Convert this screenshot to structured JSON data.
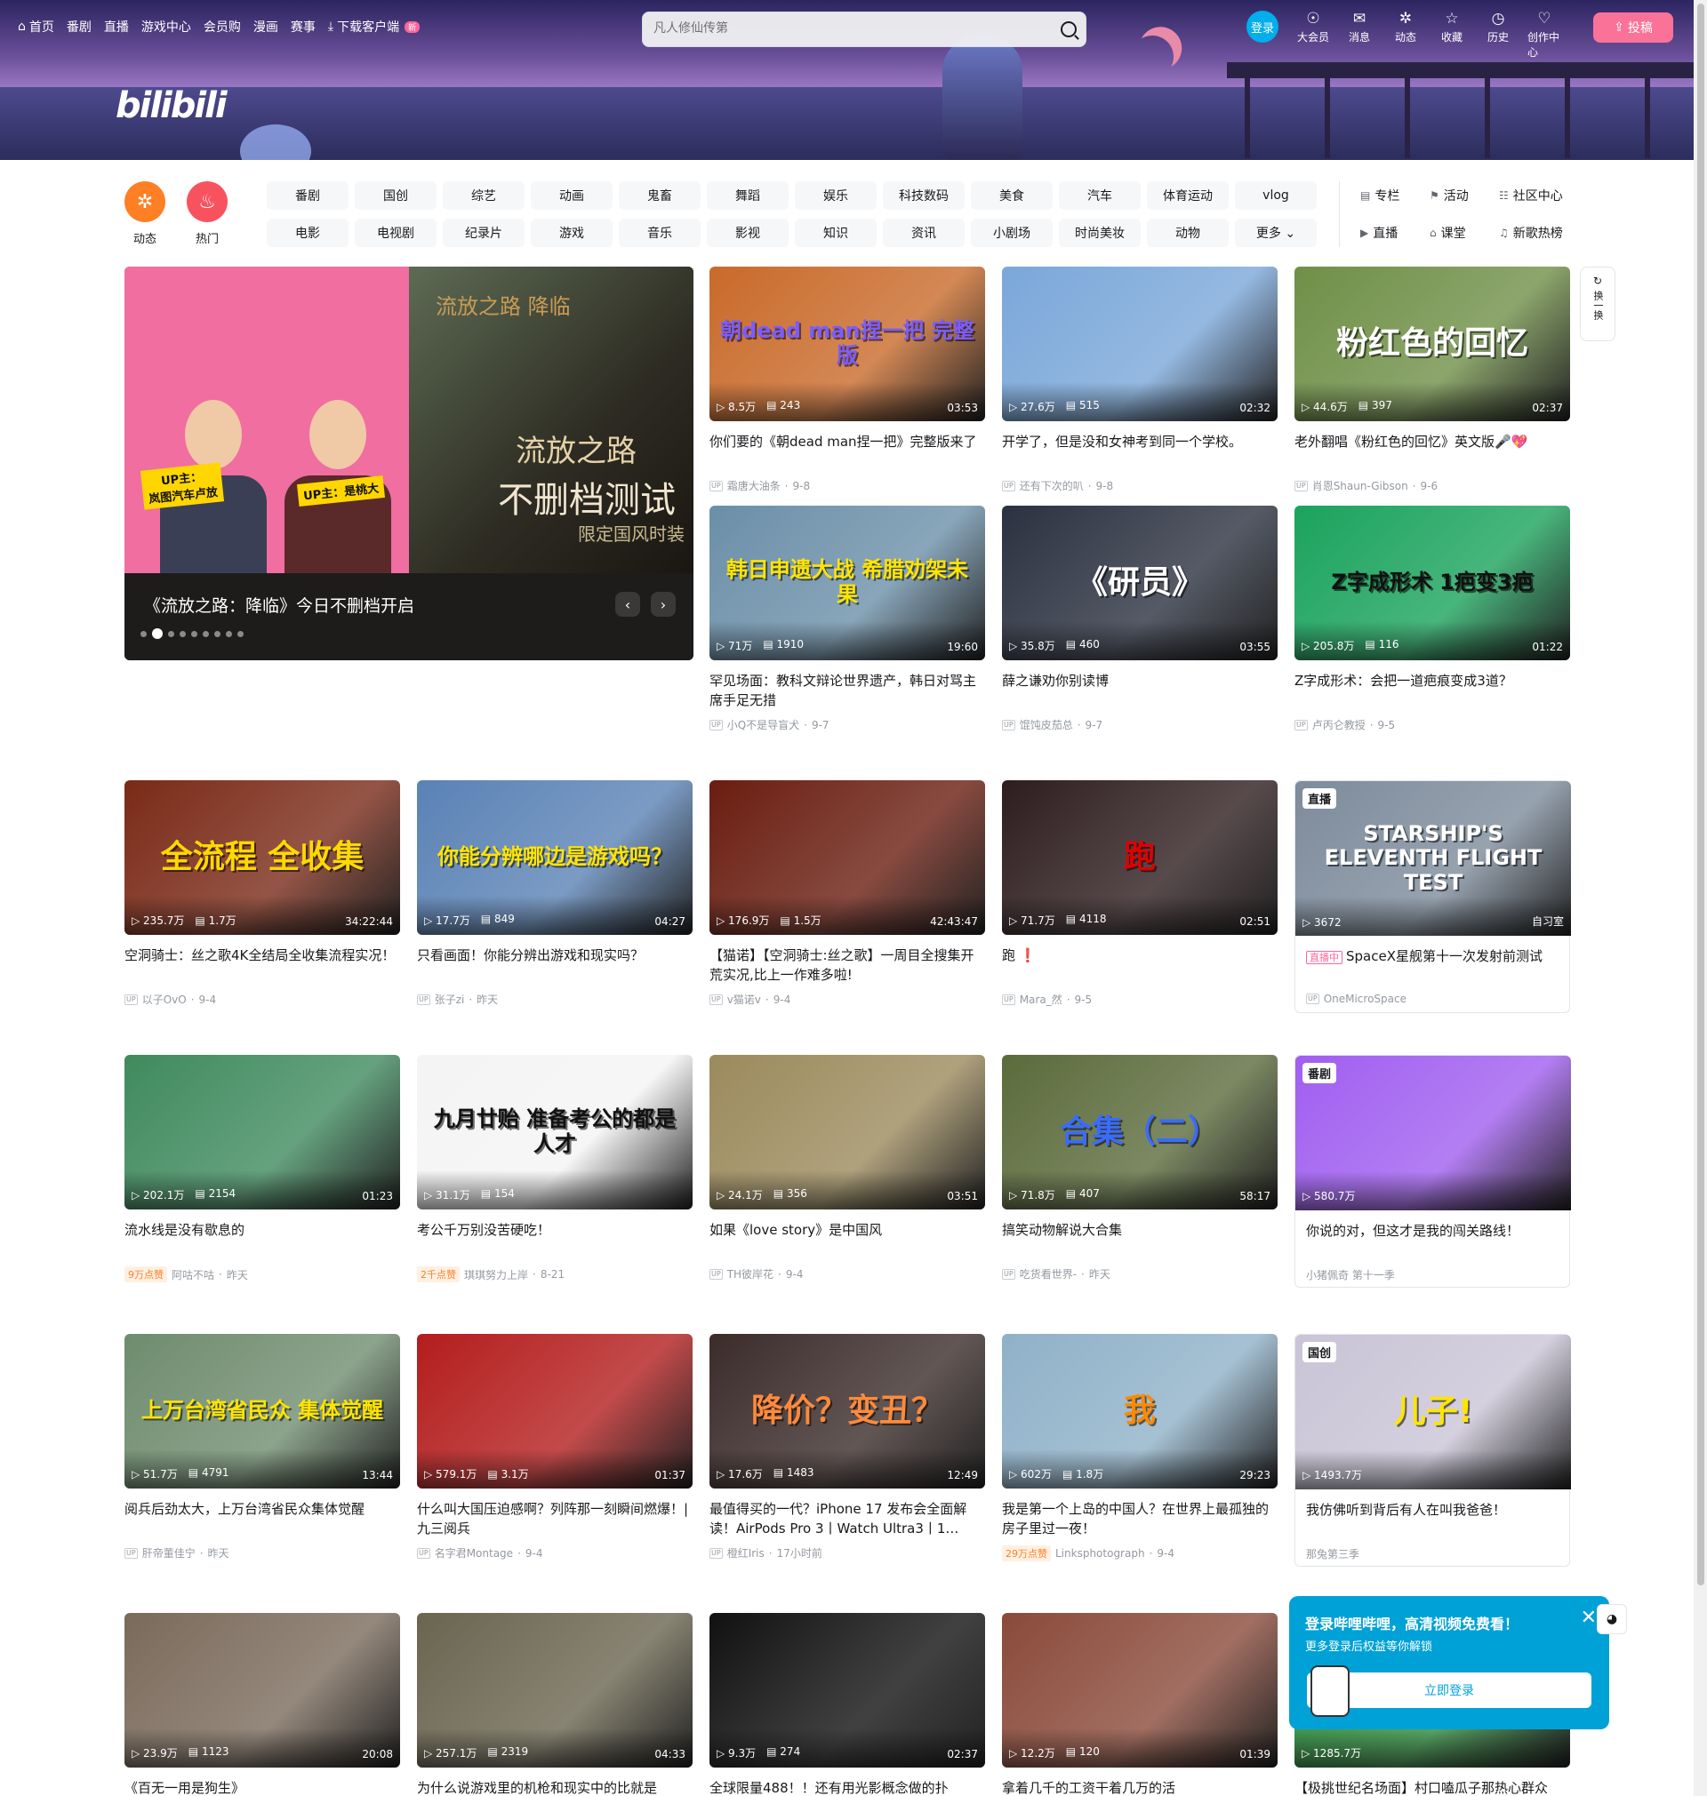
{
  "header": {
    "nav": [
      {
        "label": "首页",
        "icon": "home-icon"
      },
      {
        "label": "番剧"
      },
      {
        "label": "直播"
      },
      {
        "label": "游戏中心"
      },
      {
        "label": "会员购"
      },
      {
        "label": "漫画"
      },
      {
        "label": "赛事"
      },
      {
        "label": "下载客户端",
        "icon": "download-icon",
        "badge": "新"
      }
    ],
    "logo_text": "bilibili",
    "search_placeholder": "凡人修仙传第",
    "login_label": "登录",
    "icons": [
      {
        "label": "大会员",
        "glyph": "☉"
      },
      {
        "label": "消息",
        "glyph": "✉"
      },
      {
        "label": "动态",
        "glyph": "✲"
      },
      {
        "label": "收藏",
        "glyph": "☆"
      },
      {
        "label": "历史",
        "glyph": "◷"
      },
      {
        "label": "创作中心",
        "glyph": "♡"
      }
    ],
    "upload_label": "投稿"
  },
  "channels": {
    "circles": [
      {
        "label": "动态",
        "color": "#ff7f24",
        "glyph": "✲"
      },
      {
        "label": "热门",
        "color": "#f9525f",
        "glyph": "♨"
      }
    ],
    "tags": [
      "番剧",
      "国创",
      "综艺",
      "动画",
      "鬼畜",
      "舞蹈",
      "娱乐",
      "科技数码",
      "美食",
      "汽车",
      "体育运动",
      "vlog",
      "电影",
      "电视剧",
      "纪录片",
      "游戏",
      "音乐",
      "影视",
      "知识",
      "资讯",
      "小剧场",
      "时尚美妆",
      "动物",
      "更多 ⌄"
    ],
    "side": [
      {
        "label": "专栏",
        "glyph": "▤"
      },
      {
        "label": "活动",
        "glyph": "⚑"
      },
      {
        "label": "社区中心",
        "glyph": "☷"
      },
      {
        "label": "直播",
        "glyph": "▶"
      },
      {
        "label": "课堂",
        "glyph": "⌂"
      },
      {
        "label": "新歌热榜",
        "glyph": "♫"
      }
    ]
  },
  "carousel": {
    "title": "《流放之路：降临》今日不删档开启",
    "left_label_1": "UP主：\n岚图汽车卢放",
    "left_label_2": "UP主：是桃大",
    "right_text_1": "流放之路",
    "right_text_2": "不删档测试",
    "right_text_3": "限定国风时装",
    "right_logo": "流放之路 降临"
  },
  "refresh_label": "换一换",
  "videos": [
    {
      "title": "你们要的《朝dead man捏一把》完整版来了",
      "author": "霜唐大油条",
      "date": "9-8",
      "views": "8.5万",
      "danmaku": "243",
      "duration": "03:53",
      "overlay": "朝dead man捏一把 完整版",
      "bg": "#c96a2a",
      "oc": "#7b5cff"
    },
    {
      "title": "开学了，但是没和女神考到同一个学校。",
      "author": "还有下次的叭",
      "date": "9-8",
      "views": "27.6万",
      "danmaku": "515",
      "duration": "02:32",
      "overlay": "",
      "bg": "#7aa7d9",
      "oc": "#fff"
    },
    {
      "title": "老外翻唱《粉红色的回忆》英文版🎤💖",
      "author": "肖恩Shaun-Gibson",
      "date": "9-6",
      "views": "44.6万",
      "danmaku": "397",
      "duration": "02:37",
      "overlay": "粉红色的回忆",
      "bg": "#6f8f47",
      "oc": "#fff"
    },
    {
      "title": "罕见场面：教科文辩论世界遗产，韩日对骂主席手足无措",
      "author": "小Q不是导盲犬",
      "date": "9-7",
      "views": "71万",
      "danmaku": "1910",
      "duration": "19:60",
      "overlay": "韩日申遗大战 希腊劝架未果",
      "bg": "#6b8fa8",
      "oc": "#ffe500"
    },
    {
      "title": "薛之谦劝你别读博",
      "author": "馄饨皮茄总",
      "date": "9-7",
      "views": "35.8万",
      "danmaku": "460",
      "duration": "03:55",
      "overlay": "《研员》",
      "bg": "#2b3140",
      "oc": "#fff"
    },
    {
      "title": "Z字成形术：会把一道疤痕变成3道？",
      "author": "卢丙仑教授",
      "date": "9-5",
      "views": "205.8万",
      "danmaku": "116",
      "duration": "01:22",
      "overlay": "Z字成形术 1疤变3疤",
      "bg": "#1aa35c",
      "oc": "#111"
    },
    {
      "title": "空洞骑士：丝之歌4K全结局全收集流程实况！",
      "author": "以子OvO",
      "date": "9-4",
      "views": "235.7万",
      "danmaku": "1.7万",
      "duration": "34:22:44",
      "overlay": "全流程 全收集",
      "bg": "#7a2a17",
      "oc": "#ffd800"
    },
    {
      "title": "只看画面！你能分辨出游戏和现实吗？",
      "author": "张子zi",
      "date": "昨天",
      "views": "17.7万",
      "danmaku": "849",
      "duration": "04:27",
      "overlay": "你能分辨哪边是游戏吗？",
      "bg": "#5a82b5",
      "oc": "#ffe500"
    },
    {
      "title": "【猫诺】【空洞骑士:丝之歌】一周目全搜集开荒实况,比上一作难多啦!",
      "author": "v猫诺v",
      "date": "9-4",
      "views": "176.9万",
      "danmaku": "1.5万",
      "duration": "42:43:47",
      "overlay": "",
      "bg": "#6a1d10",
      "oc": "#fff"
    },
    {
      "title": "跑 ❗",
      "author": "Mara_然",
      "date": "9-5",
      "views": "71.7万",
      "danmaku": "4118",
      "duration": "02:51",
      "overlay": "跑",
      "bg": "#2e1d1f",
      "oc": "#e00000"
    },
    {
      "title": "SpaceX星舰第十一次发射前测试",
      "author": "OneMicroSpace",
      "date": "",
      "views": "3672",
      "danmaku": "",
      "duration": "自习室",
      "overlay": "STARSHIP'S ELEVENTH FLIGHT TEST",
      "bg": "#7d8b9b",
      "oc": "#fff",
      "live": "直播",
      "livebadge": "直播中"
    },
    {
      "title": "流水线是没有歇息的",
      "author": "阿咕不咕",
      "date": "昨天",
      "views": "202.1万",
      "danmaku": "2154",
      "duration": "01:23",
      "overlay": "",
      "bg": "#3f8a5e",
      "oc": "#fff",
      "fire": "9万点赞"
    },
    {
      "title": "考公千万别没苦硬吃！",
      "author": "琪琪努力上岸",
      "date": "8-21",
      "views": "31.1万",
      "danmaku": "154",
      "duration": "",
      "overlay": "九月廿贻 准备考公的都是人才",
      "bg": "#f4f4f4",
      "oc": "#111",
      "fire": "2千点赞"
    },
    {
      "title": "如果《love story》是中国风",
      "author": "TH彼岸花",
      "date": "9-4",
      "views": "24.1万",
      "danmaku": "356",
      "duration": "03:51",
      "overlay": "",
      "bg": "#9b8a5c",
      "oc": "#fff"
    },
    {
      "title": "搞笑动物解说大合集",
      "author": "吃货看世界-",
      "date": "昨天",
      "views": "71.8万",
      "danmaku": "407",
      "duration": "58:17",
      "overlay": "合集（二）",
      "bg": "#5b6b3b",
      "oc": "#3a6bff"
    },
    {
      "title": "你说的对，但这才是我的闯关路线！",
      "author": "小猪佩奇 第十一季",
      "date": "",
      "views": "580.7万",
      "danmaku": "",
      "duration": "",
      "overlay": "",
      "bg": "#a05ef0",
      "oc": "#fff",
      "live": "番剧"
    },
    {
      "title": "阅兵后劲太大，上万台湾省民众集体觉醒",
      "author": "肝帝董佳宁",
      "date": "昨天",
      "views": "51.7万",
      "danmaku": "4791",
      "duration": "13:44",
      "overlay": "上万台湾省民众 集体觉醒",
      "bg": "#6f8c6f",
      "oc": "#ffe500"
    },
    {
      "title": "什么叫大国压迫感啊？列阵那一刻瞬间燃爆！| 九三阅兵",
      "author": "名字君Montage",
      "date": "9-4",
      "views": "579.1万",
      "danmaku": "3.1万",
      "duration": "01:37",
      "overlay": "",
      "bg": "#b41d1d",
      "oc": "#fff"
    },
    {
      "title": "最值得买的一代？iPhone 17 发布会全面解读！AirPods Pro 3丨Watch Ultra3丨1…",
      "author": "橙红Iris",
      "date": "17小时前",
      "views": "17.6万",
      "danmaku": "1483",
      "duration": "12:49",
      "overlay": "降价？变丑？",
      "bg": "#3b2c2a",
      "oc": "#ff8a3d"
    },
    {
      "title": "我是第一个上岛的中国人？在世界上最孤独的房子里过一夜！",
      "author": "Linksphotograph",
      "date": "9-4",
      "views": "602万",
      "danmaku": "1.8万",
      "duration": "29:23",
      "overlay": "我",
      "bg": "#8fb1c8",
      "oc": "#ff8a00",
      "fire": "29万点赞"
    },
    {
      "title": "我仿佛听到背后有人在叫我爸爸！",
      "author": "那兔第三季",
      "date": "",
      "views": "1493.7万",
      "danmaku": "",
      "duration": "",
      "overlay": "儿子!",
      "bg": "#c9c4d6",
      "oc": "#ffe500",
      "live": "国创"
    },
    {
      "title": "《百无一用是狗生》",
      "author": "",
      "date": "",
      "views": "23.9万",
      "danmaku": "1123",
      "duration": "20:08",
      "overlay": "",
      "bg": "#7a6a5b",
      "oc": "#fff"
    },
    {
      "title": "为什么说游戏里的机枪和现实中的比就是",
      "author": "",
      "date": "",
      "views": "257.1万",
      "danmaku": "2319",
      "duration": "04:33",
      "overlay": "",
      "bg": "#6a6550",
      "oc": "#fff"
    },
    {
      "title": "全球限量488！！还有用光影概念做的扑",
      "author": "",
      "date": "",
      "views": "9.3万",
      "danmaku": "274",
      "duration": "02:37",
      "overlay": "",
      "bg": "#111111",
      "oc": "#fff"
    },
    {
      "title": "拿着几千的工资干着几万的活",
      "author": "",
      "date": "",
      "views": "12.2万",
      "danmaku": "120",
      "duration": "01:39",
      "overlay": "",
      "bg": "#8a4a3a",
      "oc": "#fff"
    },
    {
      "title": "【极挑世纪名场面】村口嗑瓜子那热心群众",
      "author": "",
      "date": "",
      "views": "1285.7万",
      "danmaku": "",
      "duration": "",
      "overlay": "画",
      "bg": "#2f8f3f",
      "oc": "#111"
    }
  ],
  "popup": {
    "title": "登录哔哩哔哩，高清视频免费看！",
    "subtitle": "更多登录后权益等你解锁",
    "button": "立即登录"
  }
}
